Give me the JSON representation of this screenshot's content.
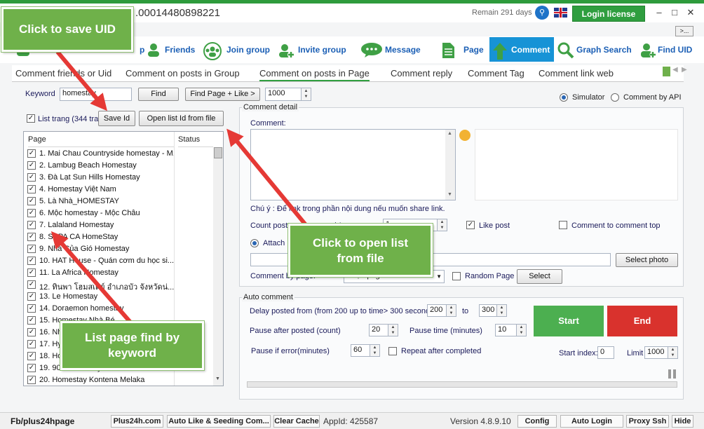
{
  "titlebar": {
    "app_id": ".00014480898221",
    "remain": "Remain 291 days",
    "login_license": "Login license",
    "more": ">..."
  },
  "toolbar": {
    "items": [
      {
        "label": "p",
        "icon": "group-icon"
      },
      {
        "label": "Friends",
        "icon": "friends-icon"
      },
      {
        "label": "Join group",
        "icon": "join-group-icon"
      },
      {
        "label": "Invite group",
        "icon": "invite-group-icon"
      },
      {
        "label": "Message",
        "icon": "message-icon"
      },
      {
        "label": "Page",
        "icon": "page-icon"
      },
      {
        "label": "Comment",
        "icon": "comment-icon"
      },
      {
        "label": "Graph Search",
        "icon": "search-icon"
      },
      {
        "label": "Find UID",
        "icon": "find-uid-icon"
      }
    ]
  },
  "subtabs": [
    "Comment friends or Uid",
    "Comment on posts in Group",
    "Comment on posts in Page",
    "Comment reply",
    "Comment Tag",
    "Comment link web"
  ],
  "left": {
    "keyword_label": "Keyword",
    "keyword_value": "homestay",
    "find": "Find",
    "find_page_like": "Find Page + Like >",
    "limit_value": "1000",
    "list_trang": "List trang (344 tran",
    "save_id": "Save Id",
    "open_list": "Open list Id from file",
    "col_page": "Page",
    "col_status": "Status",
    "rows": [
      "1. Mai Chau Countryside homestay - M...",
      "2. Lambug Beach Homestay",
      "3. Đà Lạt Sun Hills Homestay",
      "4. Homestay Việt Nam",
      "5. Là Nhà_HOMESTAY",
      "6. Mộc homestay - Mộc Châu",
      "7. Lalaland Homestay",
      "8. SAPA CA HomeStay",
      "9. Nhà Của Gió Homestay",
      "10. HAT House - Quán cơm du học si...",
      "11. La Africa Homestay",
      "12. ทินพา โฮมสเตย์ อำเภอบัว จังหวัดน่...",
      "13. Le Homestay",
      "14. Doraemon homestay",
      "15. Homestay Nhà Bé",
      "16. Nhà Homestay",
      "17. Hygge Homestay",
      "18. Hoa Homestay",
      "19. 90s Homestay",
      "20. Homestay Kontena Melaka"
    ]
  },
  "right": {
    "simulator": "Simulator",
    "comment_by_api": "Comment by API",
    "comment_detail": "Comment detail",
    "comment_label": "Comment:",
    "chu_y": "Chú ý : Để link trong phần nội dung nếu muốn share link.",
    "count_post": "Count post",
    "count_mid": "/ 1",
    "count_value": "1",
    "like_post": "Like post",
    "comment_to_top": "Comment to comment top",
    "attach": "Attach",
    "select_photo": "Select photo",
    "comment_by_page": "Comment by page:",
    "page_select": "Chọn page",
    "random_page": "Random Page",
    "select": "Select",
    "auto_comment": "Auto comment",
    "delay_label": "Delay posted from (from 200 up to time> 300 seconds)",
    "delay_from": "200",
    "to": "to",
    "delay_to": "300",
    "pause_after_label": "Pause after posted (count)",
    "pause_after": "20",
    "pause_time_label": "Pause time (minutes)",
    "pause_time": "10",
    "pause_error_label": "Pause if error(minutes)",
    "pause_error": "60",
    "repeat": "Repeat after completed",
    "start": "Start",
    "end": "End",
    "start_index_label": "Start index:",
    "start_index": "0",
    "limit_label": "Limit",
    "limit": "1000"
  },
  "annotations": {
    "save_uid": "Click to save UID",
    "open_list": "Click to open list from file",
    "list_page": "List page find by keyword"
  },
  "statusbar": {
    "fb": "Fb/plus24hpage",
    "plus24h": "Plus24h.com",
    "auto_like": "Auto Like & Seeding Com...",
    "clear_cache": "Clear Cache",
    "appid": "AppId: 425587",
    "version": "Version 4.8.9.10",
    "config": "Config",
    "auto_login": "Auto Login",
    "proxy_ssh": "Proxy Ssh",
    "hide": "Hide"
  },
  "colors": {
    "accent_green": "#2f9e3f",
    "callout_green": "#6fb14a",
    "active_tab_blue": "#1793d6",
    "start_green": "#4caf50",
    "end_red": "#d9322d",
    "arrow_red": "#e53935"
  }
}
